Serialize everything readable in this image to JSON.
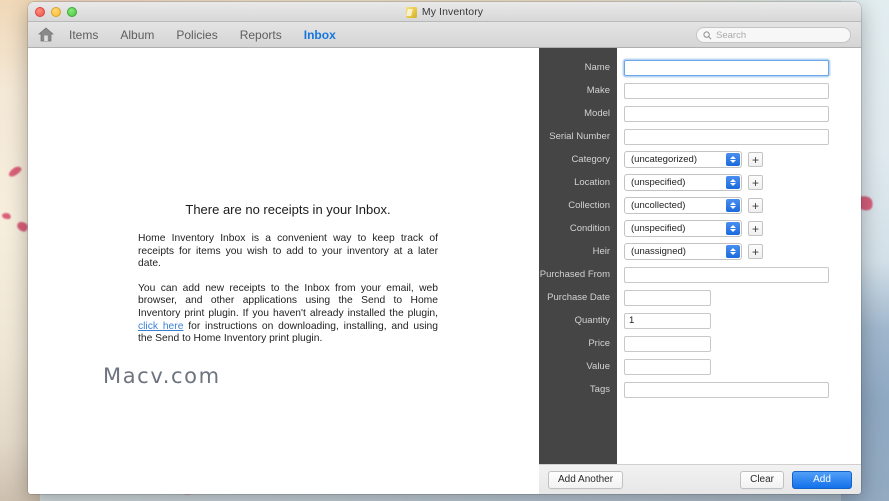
{
  "window": {
    "title": "My Inventory",
    "app_icon": "inventory-app-icon",
    "traffic_lights": [
      "close",
      "minimize",
      "zoom"
    ]
  },
  "toolbar": {
    "home_icon": "home-icon",
    "items": [
      {
        "label": "Items",
        "active": false
      },
      {
        "label": "Album",
        "active": false
      },
      {
        "label": "Policies",
        "active": false
      },
      {
        "label": "Reports",
        "active": false
      },
      {
        "label": "Inbox",
        "active": true
      }
    ],
    "search": {
      "icon": "search-icon",
      "placeholder": "Search",
      "value": ""
    },
    "active_color": "#1675e0"
  },
  "inbox": {
    "title": "There are no receipts in your Inbox.",
    "paragraph_1": "Home Inventory Inbox is a convenient way to keep track of receipts for items you wish to add to your inventory at a later date.",
    "paragraph_2_before_link": "You can add new receipts to the Inbox from your email, web browser, and other applications using the Send to Home Inventory print plugin. If you haven't already installed the plugin, ",
    "link_text": "click here",
    "paragraph_2_after_link": " for instructions on downloading, installing, and using the Send to Home Inventory print plugin.",
    "watermark": "Macv.com"
  },
  "form": {
    "fields": [
      {
        "label": "Name",
        "type": "text",
        "value": "",
        "width": "wide",
        "focused": true
      },
      {
        "label": "Make",
        "type": "text",
        "value": "",
        "width": "wide",
        "focused": false
      },
      {
        "label": "Model",
        "type": "text",
        "value": "",
        "width": "wide",
        "focused": false
      },
      {
        "label": "Serial Number",
        "type": "text",
        "value": "",
        "width": "wide",
        "focused": false
      },
      {
        "label": "Category",
        "type": "popup",
        "value": "(uncategorized)",
        "add": "+"
      },
      {
        "label": "Location",
        "type": "popup",
        "value": "(unspecified)",
        "add": "+"
      },
      {
        "label": "Collection",
        "type": "popup",
        "value": "(uncollected)",
        "add": "+"
      },
      {
        "label": "Condition",
        "type": "popup",
        "value": "(unspecified)",
        "add": "+"
      },
      {
        "label": "Heir",
        "type": "popup",
        "value": "(unassigned)",
        "add": "+"
      },
      {
        "label": "Purchased From",
        "type": "text",
        "value": "",
        "width": "wide",
        "focused": false
      },
      {
        "label": "Purchase Date",
        "type": "text",
        "value": "",
        "width": "short",
        "focused": false
      },
      {
        "label": "Quantity",
        "type": "text",
        "value": "1",
        "width": "short",
        "focused": false
      },
      {
        "label": "Price",
        "type": "text",
        "value": "",
        "width": "short",
        "focused": false
      },
      {
        "label": "Value",
        "type": "text",
        "value": "",
        "width": "short",
        "focused": false
      },
      {
        "label": "Tags",
        "type": "text",
        "value": "",
        "width": "wide",
        "focused": false
      }
    ]
  },
  "actions": {
    "add_another_label": "Add Another",
    "clear_label": "Clear",
    "add_label": "Add",
    "primary_color": "#1371ea"
  }
}
